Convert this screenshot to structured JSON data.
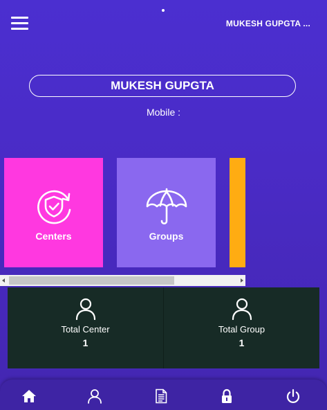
{
  "header": {
    "menu_icon": "hamburger-menu-icon",
    "user_name": "MUKESH GUPGTA ..."
  },
  "profile": {
    "name": "MUKESH GUPGTA",
    "mobile_label": "Mobile :"
  },
  "tiles": [
    {
      "label": "Centers",
      "icon": "shield-check-icon",
      "color": "#ff38e0"
    },
    {
      "label": "Groups",
      "icon": "umbrella-icon",
      "color": "#8a68ef"
    },
    {
      "label": "",
      "icon": "",
      "color": "#ffac12"
    }
  ],
  "stats": [
    {
      "label": "Total Center",
      "value": "1",
      "icon": "user-icon"
    },
    {
      "label": "Total Group",
      "value": "1",
      "icon": "user-icon"
    }
  ],
  "bottom_nav": [
    {
      "icon": "home-icon"
    },
    {
      "icon": "user-icon"
    },
    {
      "icon": "document-icon"
    },
    {
      "icon": "lock-icon"
    },
    {
      "icon": "power-icon"
    }
  ],
  "colors": {
    "background": "#4a2bc6",
    "stats_panel": "#172b26",
    "bottom_nav": "#3e24a4"
  }
}
